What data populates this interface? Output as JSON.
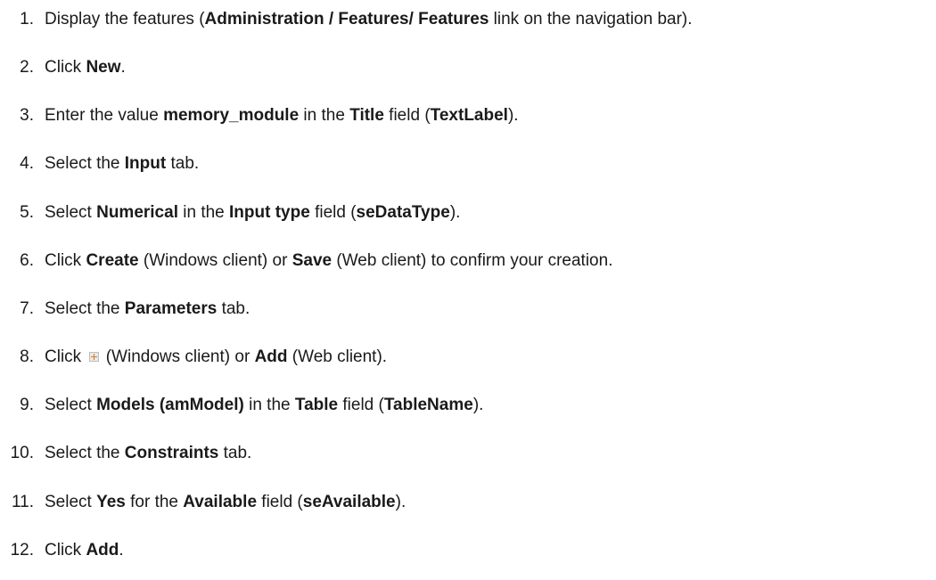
{
  "steps": [
    {
      "n": "1.",
      "parts": [
        {
          "t": "Display the features ("
        },
        {
          "t": "Administration / Features/ Features",
          "b": true
        },
        {
          "t": " link on the navigation bar)."
        }
      ]
    },
    {
      "n": "2.",
      "parts": [
        {
          "t": "Click "
        },
        {
          "t": "New",
          "b": true
        },
        {
          "t": "."
        }
      ]
    },
    {
      "n": "3.",
      "parts": [
        {
          "t": "Enter the value "
        },
        {
          "t": "memory_module",
          "b": true
        },
        {
          "t": " in the "
        },
        {
          "t": "Title",
          "b": true
        },
        {
          "t": " field ("
        },
        {
          "t": "TextLabel",
          "b": true
        },
        {
          "t": ")."
        }
      ]
    },
    {
      "n": "4.",
      "parts": [
        {
          "t": "Select the "
        },
        {
          "t": "Input",
          "b": true
        },
        {
          "t": " tab."
        }
      ]
    },
    {
      "n": "5.",
      "parts": [
        {
          "t": "Select "
        },
        {
          "t": "Numerical",
          "b": true
        },
        {
          "t": " in the "
        },
        {
          "t": "Input type",
          "b": true
        },
        {
          "t": " field ("
        },
        {
          "t": "seDataType",
          "b": true
        },
        {
          "t": ")."
        }
      ]
    },
    {
      "n": "6.",
      "parts": [
        {
          "t": "Click "
        },
        {
          "t": "Create",
          "b": true
        },
        {
          "t": " (Windows client) or "
        },
        {
          "t": "Save",
          "b": true
        },
        {
          "t": " (Web client) to confirm your creation."
        }
      ]
    },
    {
      "n": "7.",
      "parts": [
        {
          "t": "Select the "
        },
        {
          "t": "Parameters",
          "b": true
        },
        {
          "t": " tab."
        }
      ]
    },
    {
      "n": "8.",
      "parts": [
        {
          "t": "Click "
        },
        {
          "icon": "plus-icon"
        },
        {
          "t": " (Windows client) or "
        },
        {
          "t": "Add",
          "b": true
        },
        {
          "t": " (Web client)."
        }
      ]
    },
    {
      "n": "9.",
      "parts": [
        {
          "t": "Select "
        },
        {
          "t": "Models (amModel)",
          "b": true
        },
        {
          "t": " in the "
        },
        {
          "t": "Table",
          "b": true
        },
        {
          "t": " field ("
        },
        {
          "t": "TableName",
          "b": true
        },
        {
          "t": ")."
        }
      ]
    },
    {
      "n": "10.",
      "parts": [
        {
          "t": "Select the "
        },
        {
          "t": "Constraints",
          "b": true
        },
        {
          "t": " tab."
        }
      ]
    },
    {
      "n": "11.",
      "parts": [
        {
          "t": "Select "
        },
        {
          "t": "Yes",
          "b": true
        },
        {
          "t": " for the "
        },
        {
          "t": "Available",
          "b": true
        },
        {
          "t": " field ("
        },
        {
          "t": "seAvailable",
          "b": true
        },
        {
          "t": ")."
        }
      ]
    },
    {
      "n": "12.",
      "parts": [
        {
          "t": "Click "
        },
        {
          "t": "Add",
          "b": true
        },
        {
          "t": "."
        }
      ]
    }
  ]
}
